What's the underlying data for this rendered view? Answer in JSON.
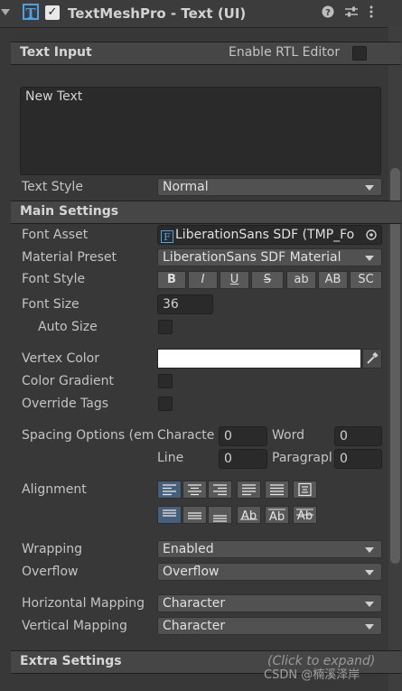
{
  "header": {
    "title": "TextMeshPro - Text (UI)",
    "icon_letter": "T",
    "enabled_check": "✓",
    "icons": [
      "help-icon",
      "presets-icon",
      "more-menu-icon"
    ]
  },
  "text_input": {
    "section_title": "Text Input",
    "rtl_label": "Enable RTL Editor",
    "text": "New Text",
    "text_style_label": "Text Style",
    "text_style_value": "Normal"
  },
  "main_settings": {
    "section_title": "Main Settings",
    "font_asset_label": "Font Asset",
    "font_asset_value": "LiberationSans SDF (TMP_Fo",
    "material_preset_label": "Material Preset",
    "material_preset_value": "LiberationSans SDF Material",
    "font_style_label": "Font Style",
    "font_style_buttons": [
      "B",
      "I",
      "U",
      "S",
      "ab",
      "AB",
      "SC"
    ],
    "font_size_label": "Font Size",
    "font_size_value": "36",
    "auto_size_label": "Auto Size",
    "vertex_color_label": "Vertex Color",
    "vertex_color": "#ffffff",
    "color_gradient_label": "Color Gradient",
    "override_tags_label": "Override Tags",
    "spacing_label": "Spacing Options (em",
    "character_label": "Characte",
    "character_value": "0",
    "word_label": "Word",
    "word_value": "0",
    "line_label": "Line",
    "line_value": "0",
    "paragraph_label": "Paragrapl",
    "paragraph_value": "0",
    "alignment_label": "Alignment",
    "wrapping_label": "Wrapping",
    "wrapping_value": "Enabled",
    "overflow_label": "Overflow",
    "overflow_value": "Overflow",
    "horizontal_mapping_label": "Horizontal Mapping",
    "horizontal_mapping_value": "Character",
    "vertical_mapping_label": "Vertical Mapping",
    "vertical_mapping_value": "Character"
  },
  "extra_settings": {
    "section_title": "Extra Settings",
    "hint": "(Click to expand)"
  },
  "watermark": "CSDN @楠溪泽岸",
  "colors": {
    "accent": "#4aa3e8",
    "selected_button": "#46607c",
    "background": "#383838"
  }
}
